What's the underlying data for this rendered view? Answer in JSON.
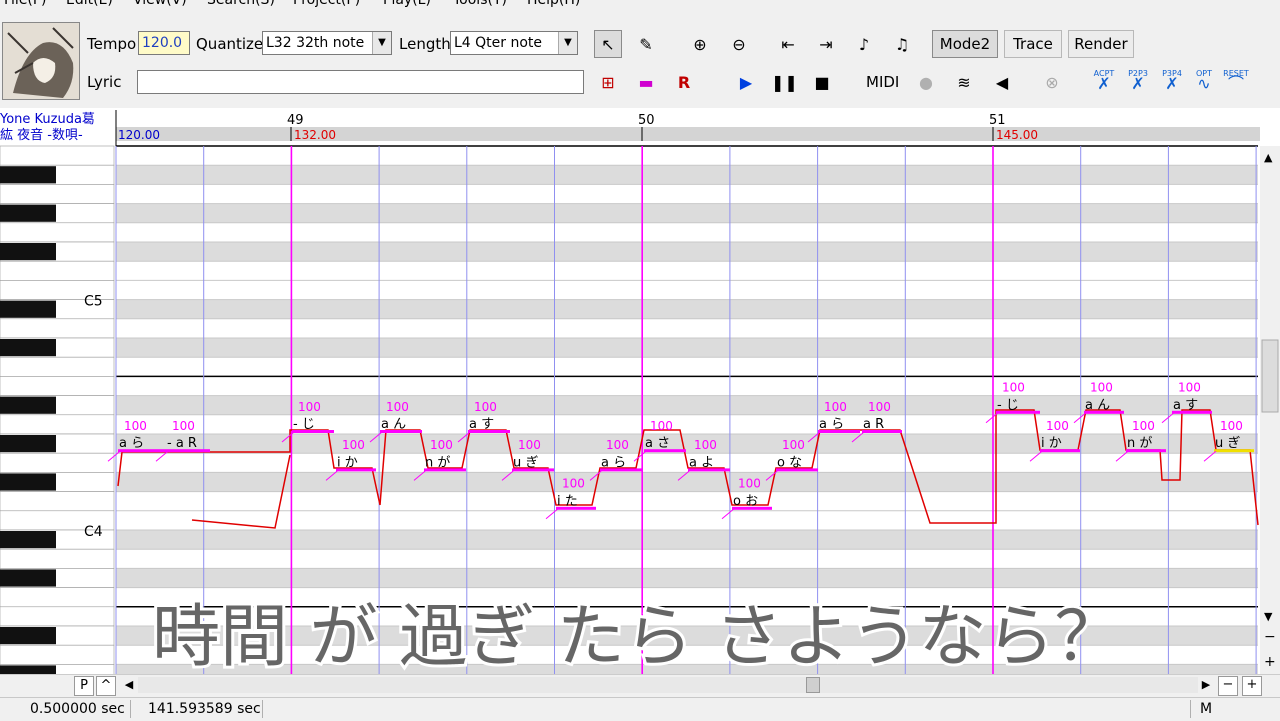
{
  "menu": [
    "File(F)",
    "Edit(E)",
    "View(V)",
    "Search(S)",
    "Project(P)",
    "Play(L)",
    "Tools(T)",
    "Help(H)"
  ],
  "toolbar": {
    "tempo_label": "Tempo",
    "tempo_value": "120.0",
    "quantize_label": "Quantize",
    "quantize_value": "L32 32th note",
    "length_label": "Length",
    "length_value": "L4  Qter note",
    "lyric_label": "Lyric",
    "lyric_value": "",
    "mode2": "Mode2",
    "trace": "Trace",
    "render": "Render",
    "midi": "MIDI",
    "icons": [
      "arrow-select-icon",
      "pencil-icon",
      "zoom-in-icon",
      "zoom-out-icon",
      "go-start-icon",
      "go-end-icon",
      "prev-note-icon",
      "next-note-icon",
      "insert-note-icon",
      "erase-note-icon",
      "add-rest-icon",
      "play-icon",
      "pause-icon",
      "stop-icon",
      "record-icon",
      "loop-icon",
      "speaker-icon",
      "link-icon",
      "curve-acpt-icon",
      "curve-p2p3-icon",
      "curve-p3p4-icon",
      "curve-opt-icon",
      "curve-reset-icon"
    ],
    "curve_labels": [
      "ACPT",
      "P2P3",
      "P3P4",
      "OPT",
      "RESET"
    ]
  },
  "track": {
    "singer": "Yone Kuzuda葛",
    "title": "紘 夜音 -数唄-"
  },
  "ruler": {
    "measures": [
      49,
      50,
      51
    ],
    "tempos": [
      "120.00",
      "132.00",
      "145.00"
    ]
  },
  "keys": {
    "c5": "C5",
    "c4": "C4"
  },
  "notes": [
    {
      "lyric": "a ら",
      "vel": "100"
    },
    {
      "lyric": "- a R",
      "vel": "100"
    },
    {
      "lyric": "- じ",
      "vel": "100"
    },
    {
      "lyric": "i か",
      "vel": "100"
    },
    {
      "lyric": "a ん",
      "vel": "100"
    },
    {
      "lyric": "n が",
      "vel": "100"
    },
    {
      "lyric": "a す",
      "vel": "100"
    },
    {
      "lyric": "u ぎ",
      "vel": "100"
    },
    {
      "lyric": "i た",
      "vel": "100"
    },
    {
      "lyric": "a ら",
      "vel": "100"
    },
    {
      "lyric": "a さ",
      "vel": "100"
    },
    {
      "lyric": "a よ",
      "vel": "100"
    },
    {
      "lyric": "o お",
      "vel": "100"
    },
    {
      "lyric": "o な",
      "vel": "100"
    },
    {
      "lyric": "a ら",
      "vel": "100"
    },
    {
      "lyric": "a R",
      "vel": "100"
    },
    {
      "lyric": "- じ",
      "vel": "100"
    },
    {
      "lyric": "i か",
      "vel": "100"
    },
    {
      "lyric": "a ん",
      "vel": "100"
    },
    {
      "lyric": "n が",
      "vel": "100"
    },
    {
      "lyric": "a す",
      "vel": "100"
    },
    {
      "lyric": "u ぎ",
      "vel": "100"
    }
  ],
  "subtitle": "時間 が 過ぎ たら さようなら？",
  "hscroll": {
    "p_label": "P",
    "caret": "^"
  },
  "zoom": {
    "minus": "−",
    "plus": "+"
  },
  "status": {
    "left": "0.500000 sec",
    "middle": "141.593589 sec",
    "right": "M"
  },
  "colors": {
    "note": "#ff00ff",
    "pitch": "#e00000",
    "grid": "#9090f0",
    "measure": "#ff00ff",
    "tempo_changed": "#e00000",
    "tempo_default": "#0000cc"
  }
}
